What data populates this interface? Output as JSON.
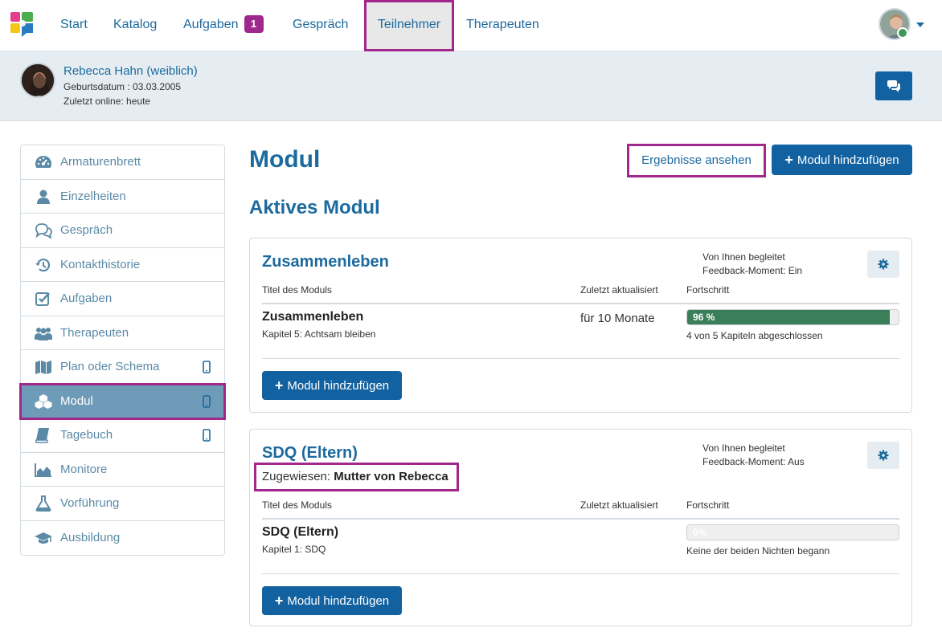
{
  "nav": {
    "items": [
      {
        "label": "Start"
      },
      {
        "label": "Katalog"
      },
      {
        "label": "Aufgaben",
        "badge": "1"
      },
      {
        "label": "Gespräch"
      },
      {
        "label": "Teilnehmer",
        "active": true
      },
      {
        "label": "Therapeuten"
      }
    ]
  },
  "patient": {
    "name": "Rebecca Hahn (weiblich)",
    "dob": "Geburtsdatum : 03.03.2005",
    "online": "Zuletzt online: heute"
  },
  "sidebar": {
    "items": [
      {
        "label": "Armaturenbrett",
        "icon": "dashboard-icon"
      },
      {
        "label": "Einzelheiten",
        "icon": "user-icon"
      },
      {
        "label": "Gespräch",
        "icon": "comments-icon"
      },
      {
        "label": "Kontakthistorie",
        "icon": "history-icon"
      },
      {
        "label": "Aufgaben",
        "icon": "check-square-icon"
      },
      {
        "label": "Therapeuten",
        "icon": "users-icon"
      },
      {
        "label": "Plan oder Schema",
        "icon": "map-icon",
        "mobile": true
      },
      {
        "label": "Modul",
        "icon": "cubes-icon",
        "mobile": true,
        "active": true
      },
      {
        "label": "Tagebuch",
        "icon": "book-icon",
        "mobile": true
      },
      {
        "label": "Monitore",
        "icon": "area-chart-icon"
      },
      {
        "label": "Vorführung",
        "icon": "flask-icon"
      },
      {
        "label": "Ausbildung",
        "icon": "graduation-cap-icon"
      }
    ]
  },
  "main": {
    "title": "Modul",
    "results_button": "Ergebnisse ansehen",
    "add_button": "Modul hindzufügen",
    "section_title": "Aktives Modul",
    "table_headers": {
      "title": "Titel des Moduls",
      "updated": "Zuletzt aktualisiert",
      "progress": "Fortschritt"
    },
    "cards": [
      {
        "title": "Zusammenleben",
        "meta_line1": "Von Ihnen begleitet",
        "meta_line2": "Feedback-Moment: Ein",
        "module_name": "Zusammenleben",
        "module_sub": "Kapitel 5: Achtsam bleiben",
        "updated": "für 10 Monate",
        "progress_percent": 96,
        "progress_label": "96 %",
        "progress_text": "4 von 5 Kapiteln abgeschlossen",
        "add_button": "Modul hindzufügen"
      },
      {
        "title": "SDQ (Eltern)",
        "assigned_label": "Zugewiesen:",
        "assigned_value": "Mutter von Rebecca",
        "meta_line1": "Von Ihnen begleitet",
        "meta_line2": "Feedback-Moment: Aus",
        "module_name": "SDQ (Eltern)",
        "module_sub": "Kapitel 1: SDQ",
        "updated": "",
        "progress_percent": 0,
        "progress_label": "0%",
        "progress_text": "Keine der beiden Nichten begann",
        "add_button": "Modul hindzufügen"
      }
    ]
  },
  "colors": {
    "brand_blue": "#1262a1",
    "link_blue": "#1c6a9e",
    "highlight_purple": "#a0278c",
    "progress_green": "#3a7f5a"
  }
}
